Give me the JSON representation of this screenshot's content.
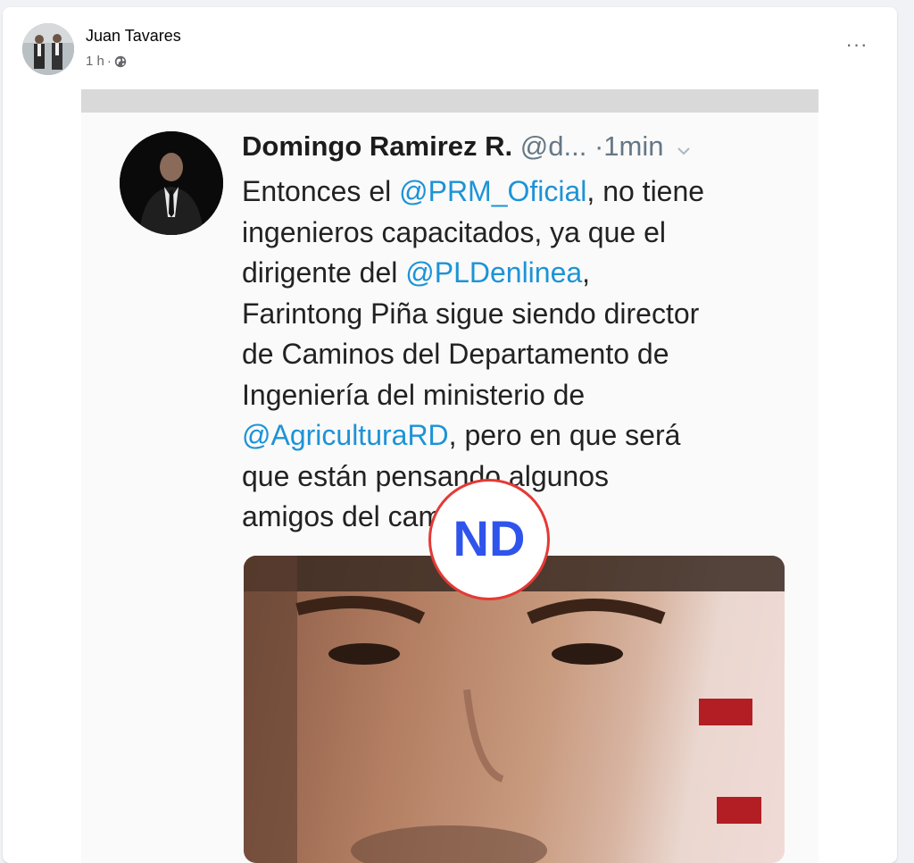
{
  "post": {
    "author": "Juan Tavares",
    "time": "1 h",
    "separator": "·",
    "more_label": "···"
  },
  "tweet": {
    "name": "Domingo Ramirez R.",
    "handle": "@d...",
    "time": "·1min",
    "body_lines": [
      [
        {
          "t": "Entonces el "
        },
        {
          "t": "@PRM_Oficial",
          "m": true
        },
        {
          "t": ", no tiene"
        }
      ],
      [
        {
          "t": "ingenieros capacitados, ya que el"
        }
      ],
      [
        {
          "t": "dirigente del "
        },
        {
          "t": "@PLDenlinea",
          "m": true
        },
        {
          "t": ","
        }
      ],
      [
        {
          "t": "Farintong Piña sigue siendo director"
        }
      ],
      [
        {
          "t": "de Caminos del Departamento de"
        }
      ],
      [
        {
          "t": "Ingeniería del ministerio de"
        }
      ],
      [
        {
          "t": "@AgriculturaRD",
          "m": true
        },
        {
          "t": ", pero en que será"
        }
      ],
      [
        {
          "t": "que están pensando algunos"
        }
      ],
      [
        {
          "t": "amigos del cambio?."
        }
      ]
    ]
  },
  "watermark": {
    "text": "ND",
    "ring_color": "#e43a36",
    "text_color": "#2f54eb"
  },
  "icons": {
    "globe": "globe-icon",
    "chevron": "chevron-down-icon",
    "more": "more-icon"
  },
  "colors": {
    "mention": "#1d93d6",
    "muted": "#65676b"
  }
}
